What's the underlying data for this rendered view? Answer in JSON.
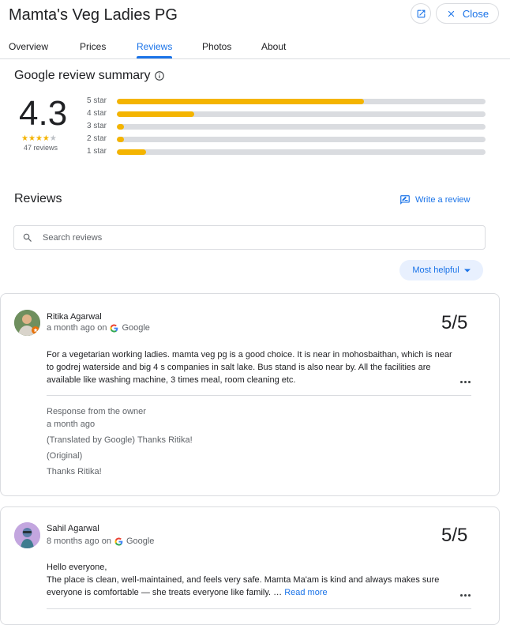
{
  "header": {
    "title": "Mamta's Veg Ladies PG",
    "close_label": "Close"
  },
  "tabs": [
    {
      "label": "Overview"
    },
    {
      "label": "Prices"
    },
    {
      "label": "Reviews",
      "active": true
    },
    {
      "label": "Photos"
    },
    {
      "label": "About"
    }
  ],
  "summary": {
    "title": "Google review summary",
    "rating": "4.3",
    "review_count": "47 reviews",
    "stars_filled": 4,
    "stars_total": 5,
    "distribution": [
      {
        "label": "5 star",
        "fraction": 0.67
      },
      {
        "label": "4 star",
        "fraction": 0.21
      },
      {
        "label": "3 star",
        "fraction": 0.02
      },
      {
        "label": "2 star",
        "fraction": 0.02
      },
      {
        "label": "1 star",
        "fraction": 0.08
      }
    ]
  },
  "reviews_section": {
    "heading": "Reviews",
    "write_review_label": "Write a review",
    "search_placeholder": "Search reviews",
    "sort_label": "Most helpful"
  },
  "reviews": [
    {
      "name": "Ritika Agarwal",
      "time": "a month ago on",
      "source": "Google",
      "score": "5/5",
      "text": "For a vegetarian working ladies. mamta veg pg is a good choice. It is near in mohosbaithan, which is near to godrej waterside and big 4 s companies in salt lake. Bus stand is also near by. All the facilities are available like washing machine, 3 times meal, room cleaning etc.",
      "owner_response": {
        "label": "Response from the owner",
        "time": "a month ago",
        "translated": "(Translated by Google) Thanks Ritika!",
        "original_label": "(Original)",
        "original": "Thanks Ritika!"
      }
    },
    {
      "name": "Sahil Agarwal",
      "time": "8 months ago on",
      "source": "Google",
      "score": "5/5",
      "text_line1": "Hello everyone,",
      "text_line2": "The place is clean, well-maintained, and feels very safe. Mamta Ma'am is kind and always makes sure everyone is comfortable — she treats everyone like family. …",
      "read_more": "Read more"
    }
  ],
  "colors": {
    "accent": "#1a73e8",
    "star": "#f4b400",
    "track": "#dadce0"
  }
}
